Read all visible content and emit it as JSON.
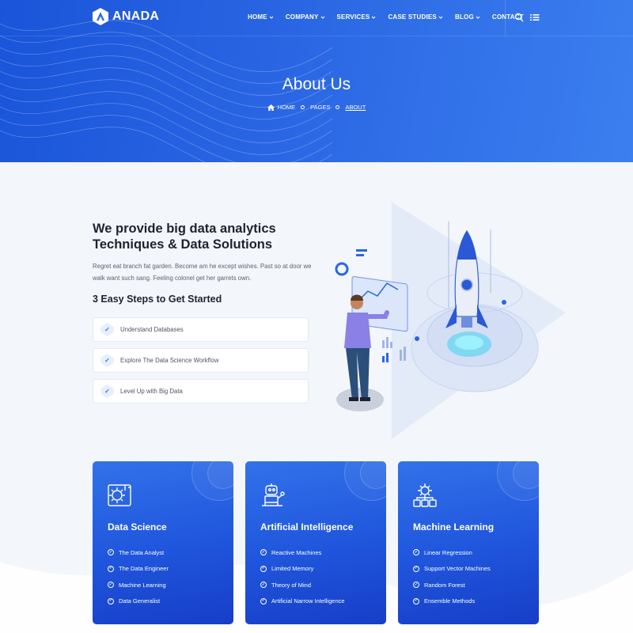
{
  "brand": {
    "name": "ANADA"
  },
  "nav": {
    "items": [
      {
        "label": "HOME",
        "has_dropdown": true
      },
      {
        "label": "COMPANY",
        "has_dropdown": true
      },
      {
        "label": "SERVICES",
        "has_dropdown": true
      },
      {
        "label": "CASE STUDIES",
        "has_dropdown": true
      },
      {
        "label": "BLOG",
        "has_dropdown": true
      },
      {
        "label": "CONTACT",
        "has_dropdown": false
      }
    ],
    "icons": [
      "search-icon",
      "list-menu-icon"
    ]
  },
  "hero": {
    "title": "About Us",
    "breadcrumb": [
      {
        "label": "HOME",
        "icon": "home-icon"
      },
      {
        "label": "PAGES"
      },
      {
        "label": "ABOUT",
        "active": true
      }
    ]
  },
  "about": {
    "heading_line1": "We provide big data analytics",
    "heading_line2": "Techniques & Data Solutions",
    "paragraph_line1": "Regret eat branch fat garden. Become am he except wishes. Past so at door we",
    "paragraph_line2": "walk want such sang. Feeling colonel get her garrets own.",
    "steps_heading": "3 Easy Steps to Get Started",
    "steps": [
      {
        "label": "Understand Databases",
        "icon": "check-icon"
      },
      {
        "label": "Explore The Data Science Workflow",
        "icon": "check-icon"
      },
      {
        "label": "Level Up with Big Data",
        "icon": "check-icon"
      }
    ]
  },
  "cards": [
    {
      "title": "Data Science",
      "icon": "data-science-gear-icon",
      "items": [
        "The Data Analyst",
        "The Data Engineer",
        "Machine Learning",
        "Data Generalist"
      ]
    },
    {
      "title": "Artificial Intelligence",
      "icon": "robot-icon",
      "items": [
        "Reactive Machines",
        "Limited Memory",
        "Theory of Mind",
        "Artificial Narrow Intelligence"
      ]
    },
    {
      "title": "Machine Learning",
      "icon": "machine-learning-gear-icon",
      "items": [
        "Linear Regression",
        "Support Vector Machines",
        "Random Forest",
        "Ensemble Methods"
      ]
    }
  ],
  "colors": {
    "primary": "#1f55dc",
    "accent_light": "#3b7ff0",
    "page_bg": "#f3f6fb",
    "text_dark": "#1d2232"
  }
}
